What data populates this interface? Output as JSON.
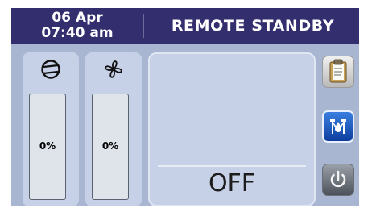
{
  "header": {
    "date": "06 Apr",
    "time": "07:40 am",
    "status": "REMOTE STANDBY"
  },
  "compressor": {
    "icon": "compressor-icon",
    "percent_label": "0%",
    "level": 0
  },
  "fan": {
    "icon": "fan-icon",
    "percent_label": "0%",
    "level": 0
  },
  "main": {
    "state": "OFF"
  },
  "buttons": [
    {
      "icon": "clipboard-icon"
    },
    {
      "icon": "water-drain-icon"
    },
    {
      "icon": "power-icon"
    }
  ],
  "colors": {
    "header_bg": "#332e6e",
    "screen_bg": "#a8b6d2",
    "panel_bg": "#c6d0e6",
    "accent_blue": "#1f5fcf"
  }
}
